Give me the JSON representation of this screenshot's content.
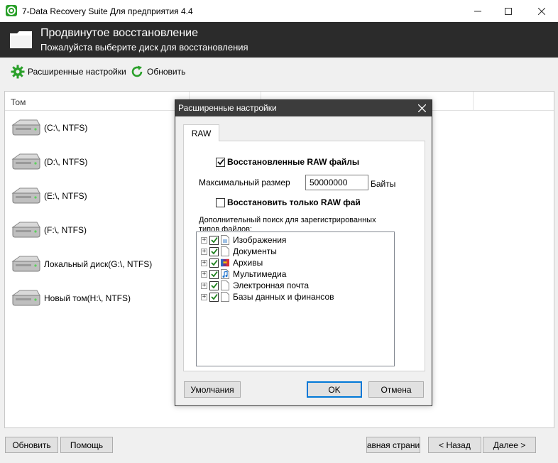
{
  "window": {
    "title": "7-Data Recovery Suite Для предприятия 4.4",
    "minimize_glyph": "—",
    "maximize_glyph": "☐",
    "close_glyph": "✕"
  },
  "header": {
    "title": "Продвинутое восстановление",
    "subtitle": "Пожалуйста выберите диск для восстановления"
  },
  "toolbar": {
    "settings_label": "Расширенные настройки",
    "refresh_label": "Обновить",
    "settings_icon": "gear-icon",
    "refresh_icon": "refresh-icon",
    "accent_color": "#2aa02a"
  },
  "list": {
    "column_header": "Том",
    "drives": [
      {
        "label": "(C:\\, NTFS)"
      },
      {
        "label": "(D:\\, NTFS)"
      },
      {
        "label": "(E:\\, NTFS)"
      },
      {
        "label": "(F:\\, NTFS)"
      },
      {
        "label": "Локальный диск(G:\\, NTFS)"
      },
      {
        "label": "Новый том(H:\\, NTFS)"
      }
    ]
  },
  "footer": {
    "refresh_label": "Обновить",
    "help_label": "Помощь",
    "home_label": "авная страни",
    "back_label": "< Назад",
    "next_label": "Далее >"
  },
  "dialog": {
    "title": "Расширенные настройки",
    "tab_label": "RAW",
    "recovered_raw_label": "Восстановленные RAW файлы",
    "recovered_raw_checked": true,
    "max_size_label": "Максимальный размер",
    "max_size_value": "50000000",
    "max_size_unit": "Байты",
    "only_raw_label": "Восстановить только RAW фай",
    "only_raw_checked": false,
    "extra_search_label_line1": "Дополнительный поиск для зарегистрированных",
    "extra_search_label_line2": "типов файлов:",
    "file_types": [
      {
        "label": "Изображения",
        "icon": "image-file-icon",
        "checked": true
      },
      {
        "label": "Документы",
        "icon": "document-file-icon",
        "checked": true
      },
      {
        "label": "Архивы",
        "icon": "archive-icon",
        "checked": true
      },
      {
        "label": "Мультимедиа",
        "icon": "music-file-icon",
        "checked": true
      },
      {
        "label": "Электронная почта",
        "icon": "document-file-icon",
        "checked": true
      },
      {
        "label": "Базы данных и финансов",
        "icon": "document-file-icon",
        "checked": true
      }
    ],
    "defaults_label": "Умолчания",
    "ok_label": "OK",
    "cancel_label": "Отмена",
    "check_color": "#1a7f1a",
    "highlight_color": "#0078d7"
  }
}
